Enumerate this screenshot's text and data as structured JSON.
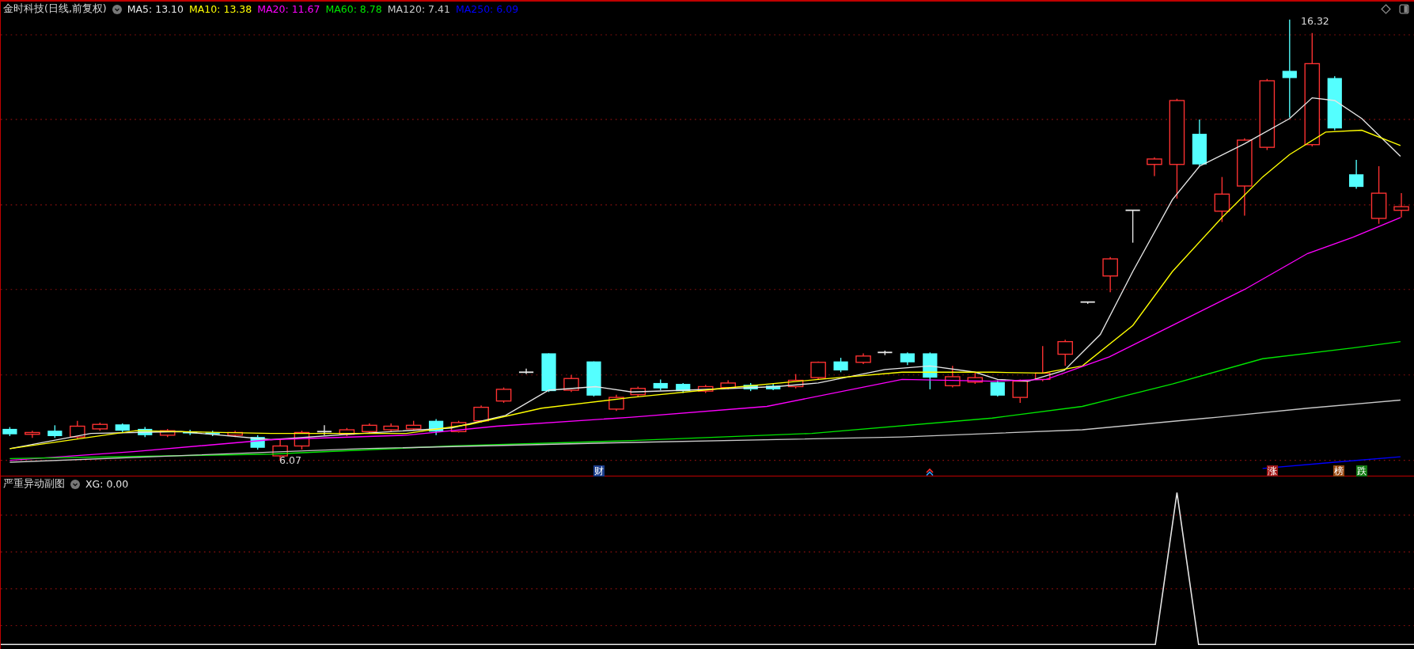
{
  "main_pane": {
    "title": "金时科技(日线,前复权)",
    "indicators": [
      {
        "label": "MA5: 13.10",
        "color": "#e6e6e6"
      },
      {
        "label": "MA10: 13.38",
        "color": "#ffff00"
      },
      {
        "label": "MA20: 11.67",
        "color": "#ff00ff"
      },
      {
        "label": "MA60: 8.78",
        "color": "#00e600"
      },
      {
        "label": "MA120: 7.41",
        "color": "#c8c8c8"
      },
      {
        "label": "MA250: 6.09",
        "color": "#0000ff"
      }
    ],
    "high_label": "16.32",
    "low_label": "6.07",
    "markers": [
      {
        "text": "财",
        "color": "#1a3d8c"
      },
      {
        "text": "涨",
        "color": "#a01818"
      },
      {
        "text": "榜",
        "color": "#9a4a14"
      },
      {
        "text": "跌",
        "color": "#127a12"
      }
    ]
  },
  "sub_pane": {
    "title": "严重异动副图",
    "indicators": [
      {
        "label": "XG: 0.00",
        "color": "#e6e6e6"
      }
    ]
  }
}
